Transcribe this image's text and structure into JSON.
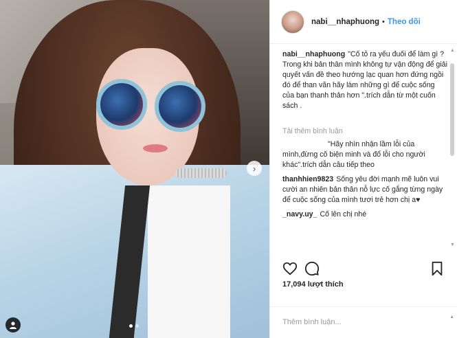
{
  "post": {
    "username": "nabi__nhaphuong",
    "separator": "•",
    "follow_label": "Theo dõi",
    "caption": "\"Cố tỏ ra yếu đuối để làm gì ? Trong khi bản thân mình không tự vận động để giải quyết vấn đề theo hướng lạc quan hơn đứng ngồi đó để than vãn hãy làm những gì để cuộc sống của bạn thanh thản hơn \".trích dẫn từ một cuốn sách .",
    "load_more": "Tải thêm bình luận",
    "comments": [
      {
        "user": "",
        "text": "\"Hãy nhìn nhận lầm lỗi của mình,đừng cố biện minh và đổ lỗi cho người khác\".trích dẫn câu tiếp theo"
      },
      {
        "user": "thanhhien9823",
        "text": "Sống yêu đời mạnh mẽ luôn vui cười an nhiên bản thân nỗ lực cố gắng từng ngày để cuộc sống của mình tươi trẻ hơn chị a♥"
      },
      {
        "user": "_navy.uy_",
        "text": "Cố lên chị nhé"
      }
    ],
    "likes": "17,094 lượt thích",
    "add_comment_placeholder": "Thêm bình luận..."
  },
  "colors": {
    "follow": "#3897f0",
    "text": "#262626",
    "muted": "#999999"
  },
  "icons": [
    "heart-icon",
    "comment-icon",
    "bookmark-icon",
    "chevron-right-icon",
    "user-tag-icon"
  ]
}
